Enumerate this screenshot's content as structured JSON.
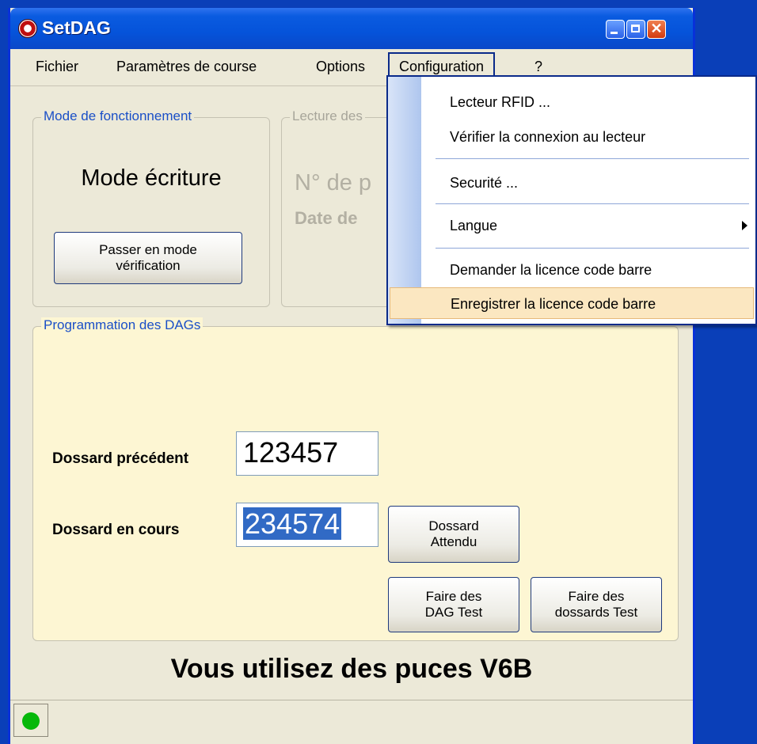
{
  "window": {
    "title": "SetDAG"
  },
  "menubar": {
    "items": [
      "Fichier",
      "Paramètres de course",
      "Options",
      "Configuration",
      "?"
    ]
  },
  "config_menu": {
    "items": [
      "Lecteur RFID ...",
      "Vérifier la connexion au lecteur",
      "Securité ...",
      "Langue",
      "Demander la licence code barre",
      "Enregistrer la licence code barre"
    ]
  },
  "mode_group": {
    "label": "Mode de fonctionnement",
    "mode_text": "Mode écriture",
    "switch_button": "Passer en mode\nvérification"
  },
  "lecture_group": {
    "label": "Lecture des",
    "line1": "N° de p",
    "line2": "Date de"
  },
  "prog_group": {
    "label": "Programmation des DAGs",
    "prev_label": "Dossard précédent",
    "prev_value": "123457",
    "current_label": "Dossard en cours",
    "current_value": "234574",
    "btn_expected": "Dossard\nAttendu",
    "btn_test_dag": "Faire des\nDAG Test",
    "btn_test_bib": "Faire des\ndossards Test"
  },
  "footer": {
    "message": "Vous utilisez des puces V6B"
  },
  "colors": {
    "titlebar": "#0553da",
    "highlight": "#fbe7c1",
    "status_ok": "#06b80a",
    "selection": "#316ac5"
  }
}
